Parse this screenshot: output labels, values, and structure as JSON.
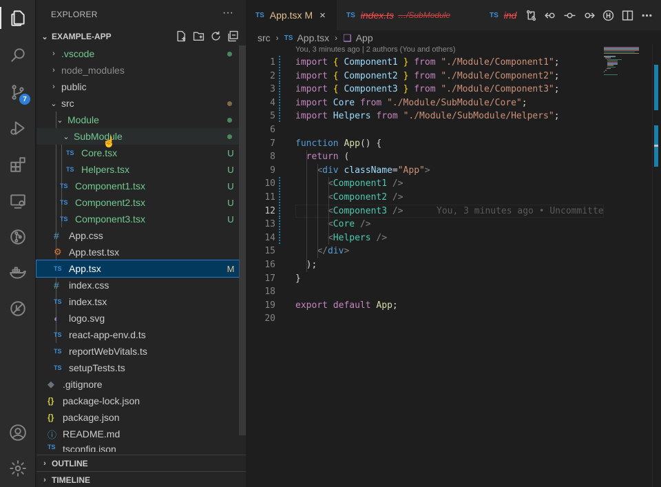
{
  "activity_bar": {
    "scm_badge": "7"
  },
  "explorer": {
    "title": "EXPLORER",
    "more": "···",
    "project": "EXAMPLE-APP",
    "tree": [
      {
        "label": ".vscode",
        "type": "folder",
        "open": false,
        "depth": 1,
        "status": "dot-green"
      },
      {
        "label": "node_modules",
        "type": "folder",
        "open": false,
        "depth": 1,
        "status": ""
      },
      {
        "label": "public",
        "type": "folder",
        "open": false,
        "depth": 1,
        "status": ""
      },
      {
        "label": "src",
        "type": "folder",
        "open": true,
        "depth": 1,
        "status": "dot-gray"
      },
      {
        "label": "Module",
        "type": "folder",
        "open": true,
        "depth": 2,
        "status": "dot-green"
      },
      {
        "label": "SubModule",
        "type": "folder",
        "open": true,
        "depth": 3,
        "status": "dot-green"
      },
      {
        "label": "Core.tsx",
        "type": "ts",
        "depth": 4,
        "status": "U"
      },
      {
        "label": "Helpers.tsx",
        "type": "ts",
        "depth": 4,
        "status": "U"
      },
      {
        "label": "Component1.tsx",
        "type": "ts",
        "depth": 3,
        "status": "U"
      },
      {
        "label": "Component2.tsx",
        "type": "ts",
        "depth": 3,
        "status": "U"
      },
      {
        "label": "Component3.tsx",
        "type": "ts",
        "depth": 3,
        "status": "U"
      },
      {
        "label": "App.css",
        "type": "css",
        "depth": 2,
        "status": ""
      },
      {
        "label": "App.test.tsx",
        "type": "test",
        "depth": 2,
        "status": ""
      },
      {
        "label": "App.tsx",
        "type": "ts",
        "depth": 2,
        "status": "M",
        "selected": true
      },
      {
        "label": "index.css",
        "type": "css",
        "depth": 2,
        "status": ""
      },
      {
        "label": "index.tsx",
        "type": "ts",
        "depth": 2,
        "status": ""
      },
      {
        "label": "logo.svg",
        "type": "svg",
        "depth": 2,
        "status": ""
      },
      {
        "label": "react-app-env.d.ts",
        "type": "ts",
        "depth": 2,
        "status": ""
      },
      {
        "label": "reportWebVitals.ts",
        "type": "ts",
        "depth": 2,
        "status": ""
      },
      {
        "label": "setupTests.ts",
        "type": "ts",
        "depth": 2,
        "status": ""
      },
      {
        "label": ".gitignore",
        "type": "git",
        "depth": 1,
        "status": ""
      },
      {
        "label": "package-lock.json",
        "type": "json",
        "depth": 1,
        "status": ""
      },
      {
        "label": "package.json",
        "type": "json",
        "depth": 1,
        "status": ""
      },
      {
        "label": "README.md",
        "type": "info",
        "depth": 1,
        "status": ""
      },
      {
        "label": "tsconfig.json",
        "type": "ts",
        "depth": 1,
        "status": ""
      }
    ],
    "outline_label": "OUTLINE",
    "timeline_label": "TIMELINE"
  },
  "tabs": [
    {
      "icon": "TS",
      "label": "App.tsx",
      "status": "M",
      "close": "×",
      "active": true
    },
    {
      "icon": "TS",
      "label": "index.ts",
      "path": "…/SubModule",
      "deleted": true
    },
    {
      "icon": "TS",
      "label": "ind",
      "deleted": true
    }
  ],
  "breadcrumb": {
    "folder": "src",
    "file": "App.tsx",
    "symbol": "App",
    "ts_icon": "TS"
  },
  "blame": {
    "top": "You, 3 minutes ago | 2 authors (You and others)",
    "inline": "You, 3 minutes ago • Uncommitte"
  },
  "code": {
    "current_line": 12,
    "lines": [
      "import { Component1 } from \"./Module/Component1\";",
      "import { Component2 } from \"./Module/Component2\";",
      "import { Component3 } from \"./Module/Component3\";",
      "import Core from \"./Module/SubModule/Core\";",
      "import Helpers from \"./Module/SubModule/Helpers\";",
      "",
      "function App() {",
      "  return (",
      "    <div className=\"App\">",
      "      <Component1 />",
      "      <Component2 />",
      "      <Component3 />",
      "      <Core />",
      "      <Helpers />",
      "    </div>",
      "  );",
      "}",
      "",
      "export default App;",
      ""
    ]
  }
}
